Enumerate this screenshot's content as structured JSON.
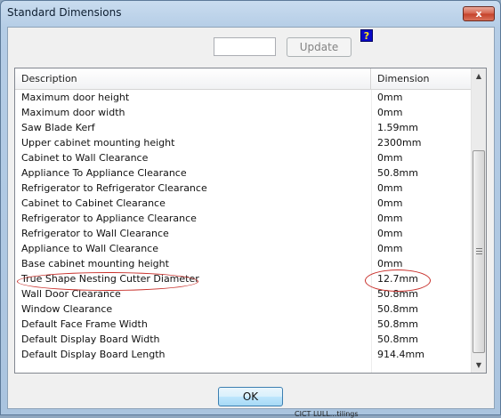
{
  "window": {
    "title": "Standard Dimensions",
    "close_glyph": "x"
  },
  "toolbar": {
    "value_input": "",
    "update_label": "Update",
    "help_glyph": "?"
  },
  "grid": {
    "headers": {
      "description": "Description",
      "dimension": "Dimension"
    },
    "rows": [
      {
        "description": "Maximum door height",
        "dimension": "0mm"
      },
      {
        "description": "Maximum door width",
        "dimension": "0mm"
      },
      {
        "description": "Saw Blade Kerf",
        "dimension": "1.59mm"
      },
      {
        "description": "Upper cabinet mounting height",
        "dimension": "2300mm"
      },
      {
        "description": "Cabinet to Wall Clearance",
        "dimension": "0mm"
      },
      {
        "description": "Appliance To Appliance Clearance",
        "dimension": "50.8mm"
      },
      {
        "description": "Refrigerator to Refrigerator Clearance",
        "dimension": "0mm"
      },
      {
        "description": "Cabinet to Cabinet Clearance",
        "dimension": "0mm"
      },
      {
        "description": "Refrigerator to Appliance Clearance",
        "dimension": "0mm"
      },
      {
        "description": "Refrigerator to Wall Clearance",
        "dimension": "0mm"
      },
      {
        "description": "Appliance to Wall Clearance",
        "dimension": "0mm"
      },
      {
        "description": "Base cabinet mounting height",
        "dimension": "0mm"
      },
      {
        "description": "True Shape Nesting Cutter Diameter",
        "dimension": "12.7mm"
      },
      {
        "description": "Wall Door Clearance",
        "dimension": "50.8mm"
      },
      {
        "description": "Window Clearance",
        "dimension": "50.8mm"
      },
      {
        "description": "Default Face Frame Width",
        "dimension": "50.8mm"
      },
      {
        "description": "Default Display Board Width",
        "dimension": "50.8mm"
      },
      {
        "description": "Default Display Board Length",
        "dimension": "914.4mm"
      }
    ],
    "scrollbar": {
      "up_glyph": "▲",
      "down_glyph": "▼"
    }
  },
  "footer": {
    "ok_label": "OK",
    "background_text": "CICT LULL...tilings"
  },
  "colors": {
    "annotation": "#c8302b",
    "title_gradient_top": "#c9dcef",
    "title_gradient_bottom": "#aac4df"
  }
}
